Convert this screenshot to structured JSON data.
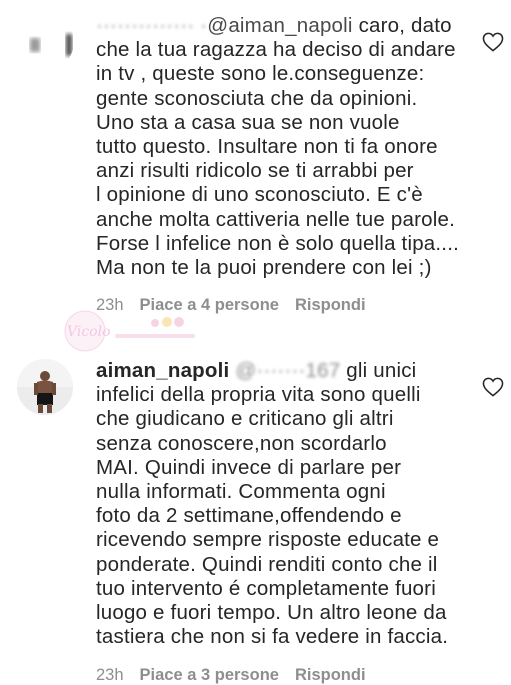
{
  "comments": [
    {
      "username_partial": "aiman_napoli",
      "blurred_prefix": "·············· ·",
      "line1_rest": " caro, dato",
      "lines": [
        "che la tua ragazza ha deciso di andare",
        "in tv , queste sono le.conseguenze:",
        "gente sconosciuta che da opinioni.",
        "Uno sta a casa sua se non vuole",
        "tutto questo. Insultare non ti fa onore",
        "anzi risulti ridicolo se ti arrabbi per",
        "l opinione di uno sconosciuto. E c'è",
        "anche molta cattiveria nelle tue parole.",
        "Forse l infelice non è solo quella tipa....",
        "Ma non te la puoi prendere con lei ;)"
      ],
      "time": "23h",
      "likes": "Piace a 4 persone",
      "reply": "Rispondi"
    },
    {
      "username": "aiman_napoli",
      "mention_blurred": "@·······167",
      "line1_rest": " gli unici",
      "lines": [
        "infelici della propria vita sono quelli",
        "che giudicano e criticano gli altri",
        "senza conoscere,non scordarlo",
        "MAI. Quindi invece di parlare per",
        "nulla informati. Commenta ogni",
        "foto da 2 settimane,offendendo e",
        "ricevendo sempre risposte educate e",
        "ponderate. Quindi renditi conto che il",
        "tuo intervento é completamente fuori",
        "luogo e fuori tempo. Un altro leone da",
        "tastiera che non si fa vedere in faccia."
      ],
      "time": "23h",
      "likes": "Piace a 3 persone",
      "reply": "Rispondi"
    }
  ],
  "watermark": {
    "text": "Vicolo",
    "color": "#e79ac9"
  },
  "colors": {
    "text": "#262626",
    "meta": "#8e8e8e"
  },
  "icons": {
    "like": "heart-outline-icon"
  }
}
